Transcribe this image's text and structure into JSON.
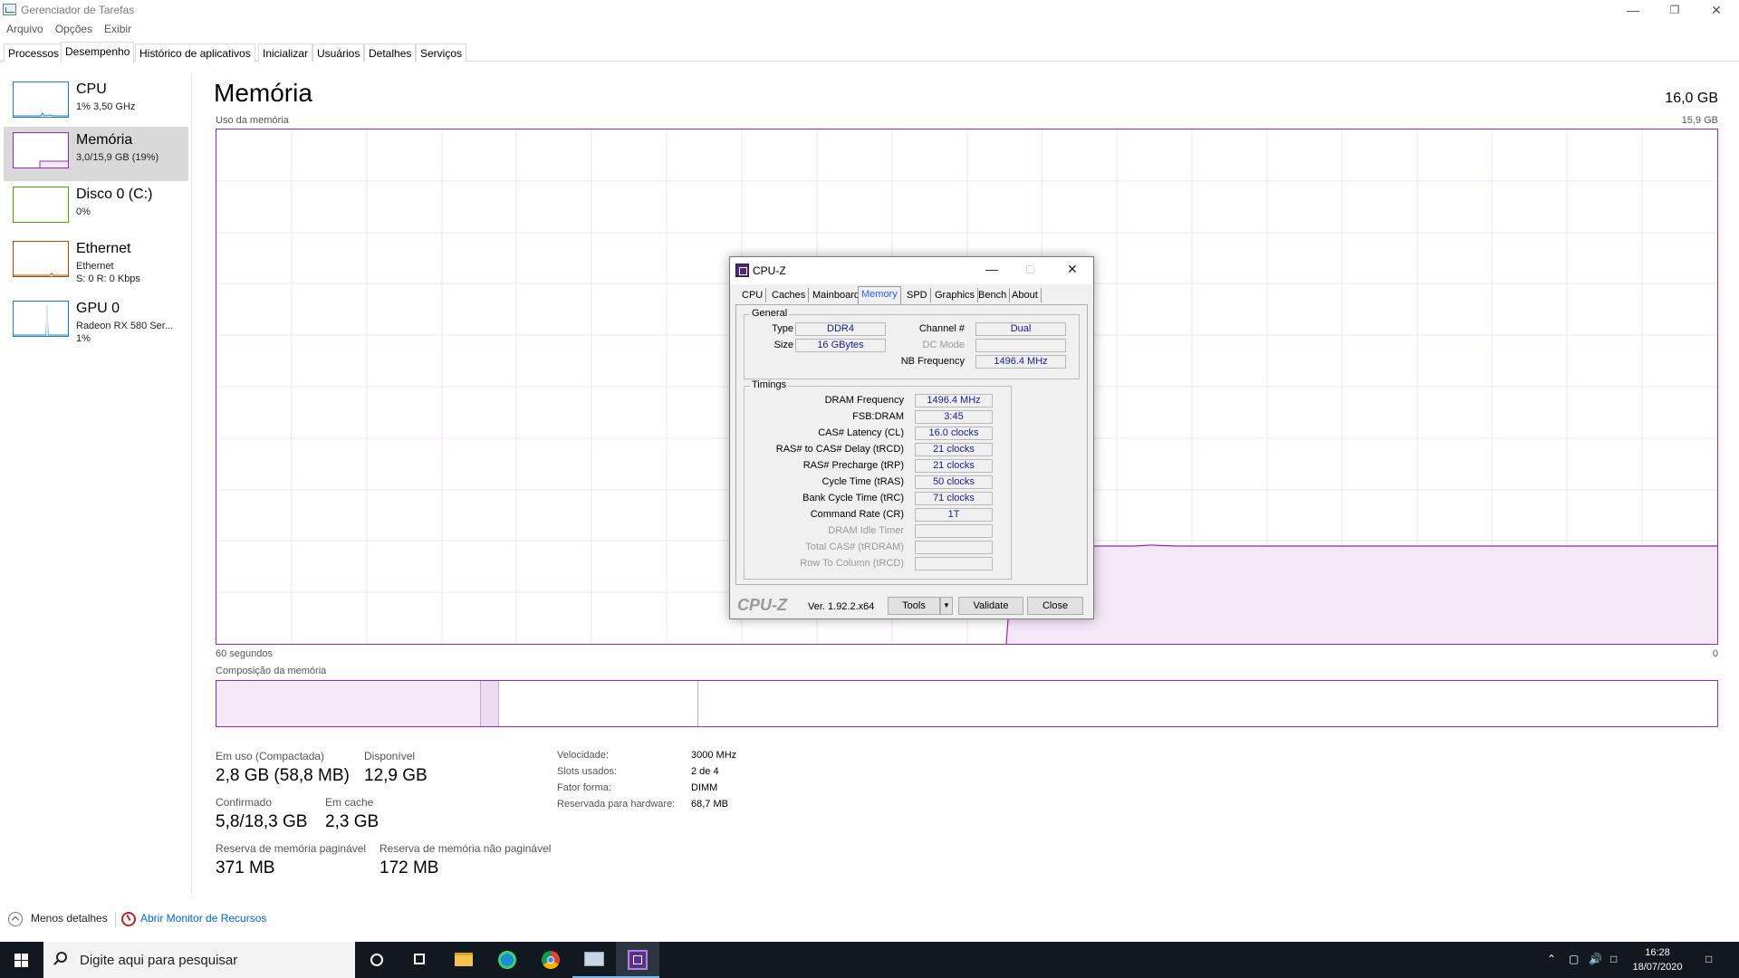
{
  "window": {
    "title": "Gerenciador de Tarefas"
  },
  "menu": [
    "Arquivo",
    "Opções",
    "Exibir"
  ],
  "tabs": [
    "Processos",
    "Desempenho",
    "Histórico de aplicativos",
    "Inicializar",
    "Usuários",
    "Detalhes",
    "Serviços"
  ],
  "active_tab": "Desempenho",
  "sidebar": {
    "items": [
      {
        "name": "CPU",
        "line1": "1% 3,50 GHz",
        "line2": "",
        "color": "#1b7fbf"
      },
      {
        "name": "Memória",
        "line1": "3,0/15,9 GB (19%)",
        "line2": "",
        "color": "#9528b4"
      },
      {
        "name": "Disco 0 (C:)",
        "line1": "0%",
        "line2": "",
        "color": "#4da60c"
      },
      {
        "name": "Ethernet",
        "line1": "Ethernet",
        "line2": "S: 0 R: 0 Kbps",
        "color": "#a74f01"
      },
      {
        "name": "GPU 0",
        "line1": "Radeon RX 580 Ser...",
        "line2": "1%",
        "color": "#1b7fbf"
      }
    ],
    "selected": "Memória"
  },
  "main": {
    "title": "Memória",
    "capacity": "16,0 GB",
    "usage_label": "Uso da memória",
    "usage_max": "15,9 GB",
    "time_left": "60 segundos",
    "time_right": "0",
    "composition_label": "Composição da memória",
    "usage_graph": {
      "level_fraction": 0.19,
      "start_fraction": 0.526
    }
  },
  "stats": {
    "in_use_label": "Em uso (Compactada)",
    "in_use_value": "2,8 GB (58,8 MB)",
    "available_label": "Disponível",
    "available_value": "12,9 GB",
    "committed_label": "Confirmado",
    "committed_value": "5,8/18,3 GB",
    "cached_label": "Em cache",
    "cached_value": "2,3 GB",
    "paged_label": "Reserva de memória paginável",
    "paged_value": "371 MB",
    "nonpaged_label": "Reserva de memória não paginável",
    "nonpaged_value": "172 MB"
  },
  "details": [
    {
      "label": "Velocidade:",
      "value": "3000 MHz"
    },
    {
      "label": "Slots usados:",
      "value": "2 de 4"
    },
    {
      "label": "Fator forma:",
      "value": "DIMM"
    },
    {
      "label": "Reservada para hardware:",
      "value": "68,7 MB"
    }
  ],
  "footer": {
    "less_details": "Menos detalhes",
    "resource_monitor": "Abrir Monitor de Recursos"
  },
  "cpuz": {
    "title": "CPU-Z",
    "tabs": [
      "CPU",
      "Caches",
      "Mainboard",
      "Memory",
      "SPD",
      "Graphics",
      "Bench",
      "About"
    ],
    "active_tab": "Memory",
    "general": {
      "title": "General",
      "type_label": "Type",
      "type_value": "DDR4",
      "size_label": "Size",
      "size_value": "16 GBytes",
      "channel_label": "Channel #",
      "channel_value": "Dual",
      "dcmode_label": "DC Mode",
      "dcmode_value": "",
      "nbfreq_label": "NB Frequency",
      "nbfreq_value": "1496.4 MHz"
    },
    "timings": {
      "title": "Timings",
      "rows": [
        {
          "label": "DRAM Frequency",
          "value": "1496.4 MHz",
          "dim": false
        },
        {
          "label": "FSB:DRAM",
          "value": "3:45",
          "dim": false
        },
        {
          "label": "CAS# Latency (CL)",
          "value": "16.0 clocks",
          "dim": false
        },
        {
          "label": "RAS# to CAS# Delay (tRCD)",
          "value": "21 clocks",
          "dim": false
        },
        {
          "label": "RAS# Precharge (tRP)",
          "value": "21 clocks",
          "dim": false
        },
        {
          "label": "Cycle Time (tRAS)",
          "value": "50 clocks",
          "dim": false
        },
        {
          "label": "Bank Cycle Time (tRC)",
          "value": "71 clocks",
          "dim": false
        },
        {
          "label": "Command Rate (CR)",
          "value": "1T",
          "dim": false
        },
        {
          "label": "DRAM Idle Timer",
          "value": "",
          "dim": true
        },
        {
          "label": "Total CAS# (tRDRAM)",
          "value": "",
          "dim": true
        },
        {
          "label": "Row To Column (tRCD)",
          "value": "",
          "dim": true
        }
      ]
    },
    "logo": "CPU-Z",
    "version": "Ver. 1.92.2.x64",
    "tools_label": "Tools",
    "validate_label": "Validate",
    "close_label": "Close"
  },
  "taskbar": {
    "search_placeholder": "Digite aqui para pesquisar",
    "time": "16:28",
    "date": "18/07/2020"
  }
}
